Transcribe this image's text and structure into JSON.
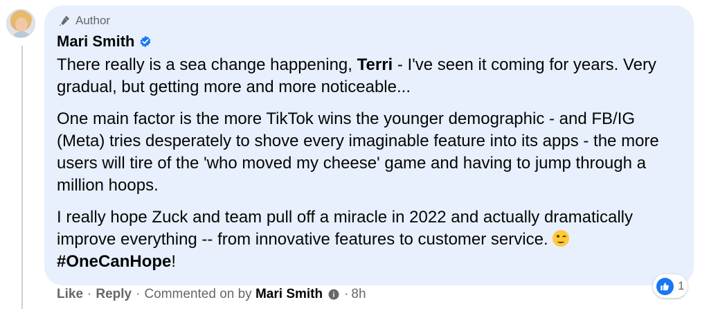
{
  "author_badge": {
    "label": "Author",
    "icon": "microphone-icon"
  },
  "comment": {
    "author": "Mari Smith",
    "verified": true,
    "paragraph1_start": "There really is a sea change happening, ",
    "mention": "Terri",
    "paragraph1_end": " - I've seen it coming for years. Very gradual, but getting more and more noticeable...",
    "paragraph2": "One main factor is the more TikTok wins the younger demographic - and FB/IG (Meta) tries desperately to shove every imaginable feature into its apps - the more users will tire of the 'who moved my cheese' game and having to jump through a million hoops.",
    "paragraph3": "I really hope Zuck and team pull off a miracle in 2022 and actually dramatically improve everything -- from innovative features to customer service. ",
    "emoji": "winking-face",
    "hashtag": "#OneCanHope",
    "exclamation": "!"
  },
  "reaction": {
    "icon": "thumbs-up-icon",
    "count": "1"
  },
  "actions": {
    "like": "Like",
    "reply": "Reply",
    "separator": "·",
    "commented_on_by": "Commented on by",
    "commented_name": "Mari Smith",
    "time": "8h"
  },
  "colors": {
    "bubble": "#e7f0fc",
    "muted": "#65676b",
    "brand": "#1877f2",
    "text": "#050505"
  }
}
